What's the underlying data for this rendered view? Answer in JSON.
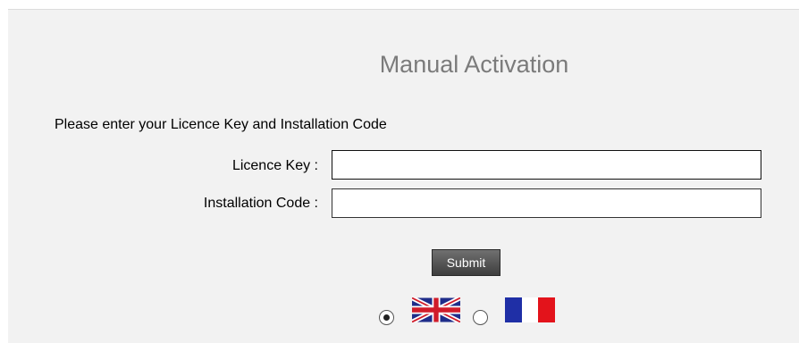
{
  "form": {
    "title": "Manual Activation",
    "instruction": "Please enter your Licence Key and Installation Code",
    "licence_key_label": "Licence Key :",
    "licence_key_value": "",
    "installation_code_label": "Installation Code :",
    "installation_code_value": "",
    "submit_label": "Submit"
  },
  "language": {
    "options": [
      {
        "icon": "uk-flag-icon",
        "selected": true
      },
      {
        "icon": "france-flag-icon",
        "selected": false
      }
    ]
  },
  "colors": {
    "panel_bg": "#f2f2f2",
    "title": "#7b7b7b",
    "button_top": "#707070",
    "button_bottom": "#3e3e3e",
    "uk_blue": "#1f2d8a",
    "uk_red": "#d01c2a",
    "fr_blue": "#1f2fa6",
    "fr_red": "#e3131b"
  }
}
